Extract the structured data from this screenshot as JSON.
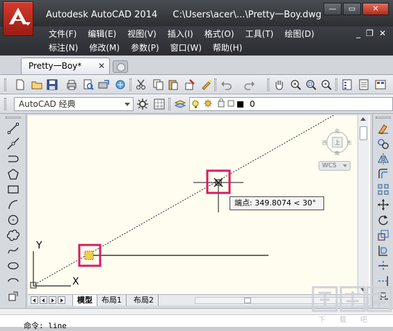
{
  "window": {
    "app_name": "Autodesk AutoCAD 2014",
    "file_path": "C:\\Users\\acer\\...\\Pretty一Boy.dwg",
    "minimize": "—",
    "restore": "▭",
    "close": "✕"
  },
  "menu": {
    "row1": [
      "文件(F)",
      "编辑(E)",
      "视图(V)",
      "插入(I)",
      "格式(O)",
      "工具(T)",
      "绘图(D)"
    ],
    "row2": [
      "标注(N)",
      "修改(M)",
      "参数(P)",
      "窗口(W)",
      "帮助(H)"
    ],
    "mdi_minimize": "_",
    "mdi_restore": "❐",
    "mdi_close": "✕"
  },
  "tabs": {
    "document_tab": "Pretty一Boy*",
    "close_glyph": "✕"
  },
  "toolbar": {
    "workspace": "AutoCAD 经典",
    "layer": "0"
  },
  "viewport": {
    "viewcube_top": "北",
    "viewcube_bottom": "南",
    "viewcube_left": "西",
    "viewcube_right": "东",
    "viewcube_face": "上",
    "wcs_label": "WCS",
    "tooltip": "端点: 349.8074 < 30°",
    "ucs_x": "X",
    "ucs_y": "Y"
  },
  "layout_tabs": [
    "模型",
    "布局1",
    "布局2"
  ],
  "command": {
    "text": "命令:  line"
  },
  "colors": {
    "canvas_bg": "#fffdf0",
    "highlight": "#d81b60",
    "title_bg": "#2c2e31",
    "logo_red": "#c0302a"
  },
  "watermark": {
    "text": "下载吧"
  }
}
